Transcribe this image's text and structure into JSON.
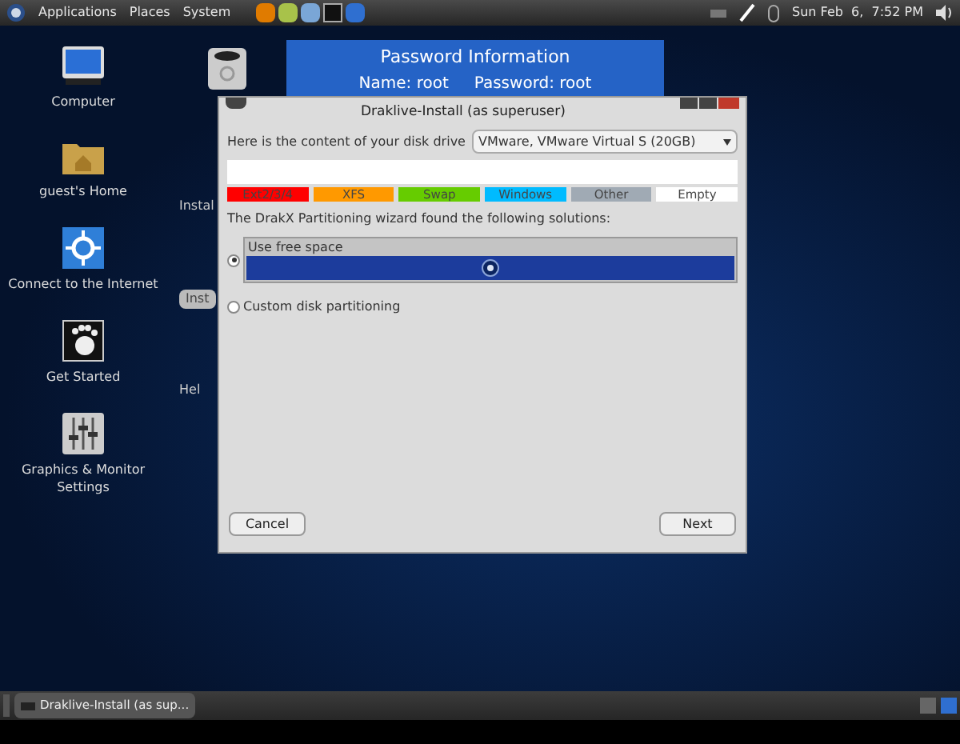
{
  "top_panel": {
    "menus": [
      "Applications",
      "Places",
      "System"
    ],
    "clock": "Sun Feb  6,  7:52 PM"
  },
  "desktop_icons": [
    {
      "label": "Computer",
      "kind": "computer"
    },
    {
      "label": "guest's Home",
      "kind": "home"
    },
    {
      "label": "Connect to the Internet",
      "kind": "network"
    },
    {
      "label": "Get Started",
      "kind": "foot"
    },
    {
      "label": "Graphics & Monitor Settings",
      "kind": "mixer"
    }
  ],
  "hidden_icons": [
    {
      "label": "Instal",
      "kind": "plain"
    },
    {
      "label": "Inst",
      "kind": "chip"
    },
    {
      "label": "Hel",
      "kind": "plain"
    }
  ],
  "password_note": {
    "title": "Password Information",
    "name": "Name: root",
    "password": "Password: root"
  },
  "dialog": {
    "title": "Draklive-Install (as superuser)",
    "drive_label": "Here is the content of your disk drive",
    "drive_value": "VMware, VMware Virtual S (20GB)",
    "legend": [
      {
        "label": "Ext2/3/4",
        "color": "#ff0000"
      },
      {
        "label": "XFS",
        "color": "#ff9900"
      },
      {
        "label": "Swap",
        "color": "#66cc00"
      },
      {
        "label": "Windows",
        "color": "#00bbff"
      },
      {
        "label": "Other",
        "color": "#a0aab4"
      },
      {
        "label": "Empty",
        "color": "#ffffff"
      }
    ],
    "solutions_label": "The DrakX Partitioning wizard found the following solutions:",
    "options": [
      {
        "label": "Use free space",
        "selected": true,
        "kind": "preview"
      },
      {
        "label": "Custom disk partitioning",
        "selected": false,
        "kind": "plain"
      }
    ],
    "buttons": [
      "Cancel",
      "Next"
    ]
  },
  "taskbar": {
    "tasks": [
      "Draklive-Install (as sup..."
    ]
  }
}
